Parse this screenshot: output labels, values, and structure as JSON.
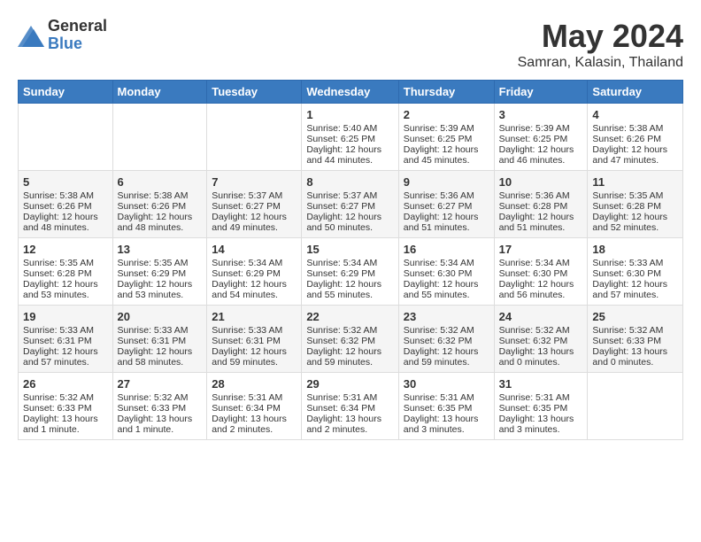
{
  "logo": {
    "general": "General",
    "blue": "Blue"
  },
  "title": "May 2024",
  "subtitle": "Samran, Kalasin, Thailand",
  "days": [
    "Sunday",
    "Monday",
    "Tuesday",
    "Wednesday",
    "Thursday",
    "Friday",
    "Saturday"
  ],
  "weeks": [
    [
      {
        "day": "",
        "data": ""
      },
      {
        "day": "",
        "data": ""
      },
      {
        "day": "",
        "data": ""
      },
      {
        "day": "1",
        "data": "Sunrise: 5:40 AM\nSunset: 6:25 PM\nDaylight: 12 hours\nand 44 minutes."
      },
      {
        "day": "2",
        "data": "Sunrise: 5:39 AM\nSunset: 6:25 PM\nDaylight: 12 hours\nand 45 minutes."
      },
      {
        "day": "3",
        "data": "Sunrise: 5:39 AM\nSunset: 6:25 PM\nDaylight: 12 hours\nand 46 minutes."
      },
      {
        "day": "4",
        "data": "Sunrise: 5:38 AM\nSunset: 6:26 PM\nDaylight: 12 hours\nand 47 minutes."
      }
    ],
    [
      {
        "day": "5",
        "data": "Sunrise: 5:38 AM\nSunset: 6:26 PM\nDaylight: 12 hours\nand 48 minutes."
      },
      {
        "day": "6",
        "data": "Sunrise: 5:38 AM\nSunset: 6:26 PM\nDaylight: 12 hours\nand 48 minutes."
      },
      {
        "day": "7",
        "data": "Sunrise: 5:37 AM\nSunset: 6:27 PM\nDaylight: 12 hours\nand 49 minutes."
      },
      {
        "day": "8",
        "data": "Sunrise: 5:37 AM\nSunset: 6:27 PM\nDaylight: 12 hours\nand 50 minutes."
      },
      {
        "day": "9",
        "data": "Sunrise: 5:36 AM\nSunset: 6:27 PM\nDaylight: 12 hours\nand 51 minutes."
      },
      {
        "day": "10",
        "data": "Sunrise: 5:36 AM\nSunset: 6:28 PM\nDaylight: 12 hours\nand 51 minutes."
      },
      {
        "day": "11",
        "data": "Sunrise: 5:35 AM\nSunset: 6:28 PM\nDaylight: 12 hours\nand 52 minutes."
      }
    ],
    [
      {
        "day": "12",
        "data": "Sunrise: 5:35 AM\nSunset: 6:28 PM\nDaylight: 12 hours\nand 53 minutes."
      },
      {
        "day": "13",
        "data": "Sunrise: 5:35 AM\nSunset: 6:29 PM\nDaylight: 12 hours\nand 53 minutes."
      },
      {
        "day": "14",
        "data": "Sunrise: 5:34 AM\nSunset: 6:29 PM\nDaylight: 12 hours\nand 54 minutes."
      },
      {
        "day": "15",
        "data": "Sunrise: 5:34 AM\nSunset: 6:29 PM\nDaylight: 12 hours\nand 55 minutes."
      },
      {
        "day": "16",
        "data": "Sunrise: 5:34 AM\nSunset: 6:30 PM\nDaylight: 12 hours\nand 55 minutes."
      },
      {
        "day": "17",
        "data": "Sunrise: 5:34 AM\nSunset: 6:30 PM\nDaylight: 12 hours\nand 56 minutes."
      },
      {
        "day": "18",
        "data": "Sunrise: 5:33 AM\nSunset: 6:30 PM\nDaylight: 12 hours\nand 57 minutes."
      }
    ],
    [
      {
        "day": "19",
        "data": "Sunrise: 5:33 AM\nSunset: 6:31 PM\nDaylight: 12 hours\nand 57 minutes."
      },
      {
        "day": "20",
        "data": "Sunrise: 5:33 AM\nSunset: 6:31 PM\nDaylight: 12 hours\nand 58 minutes."
      },
      {
        "day": "21",
        "data": "Sunrise: 5:33 AM\nSunset: 6:31 PM\nDaylight: 12 hours\nand 59 minutes."
      },
      {
        "day": "22",
        "data": "Sunrise: 5:32 AM\nSunset: 6:32 PM\nDaylight: 12 hours\nand 59 minutes."
      },
      {
        "day": "23",
        "data": "Sunrise: 5:32 AM\nSunset: 6:32 PM\nDaylight: 12 hours\nand 59 minutes."
      },
      {
        "day": "24",
        "data": "Sunrise: 5:32 AM\nSunset: 6:32 PM\nDaylight: 13 hours\nand 0 minutes."
      },
      {
        "day": "25",
        "data": "Sunrise: 5:32 AM\nSunset: 6:33 PM\nDaylight: 13 hours\nand 0 minutes."
      }
    ],
    [
      {
        "day": "26",
        "data": "Sunrise: 5:32 AM\nSunset: 6:33 PM\nDaylight: 13 hours\nand 1 minute."
      },
      {
        "day": "27",
        "data": "Sunrise: 5:32 AM\nSunset: 6:33 PM\nDaylight: 13 hours\nand 1 minute."
      },
      {
        "day": "28",
        "data": "Sunrise: 5:31 AM\nSunset: 6:34 PM\nDaylight: 13 hours\nand 2 minutes."
      },
      {
        "day": "29",
        "data": "Sunrise: 5:31 AM\nSunset: 6:34 PM\nDaylight: 13 hours\nand 2 minutes."
      },
      {
        "day": "30",
        "data": "Sunrise: 5:31 AM\nSunset: 6:35 PM\nDaylight: 13 hours\nand 3 minutes."
      },
      {
        "day": "31",
        "data": "Sunrise: 5:31 AM\nSunset: 6:35 PM\nDaylight: 13 hours\nand 3 minutes."
      },
      {
        "day": "",
        "data": ""
      }
    ]
  ]
}
